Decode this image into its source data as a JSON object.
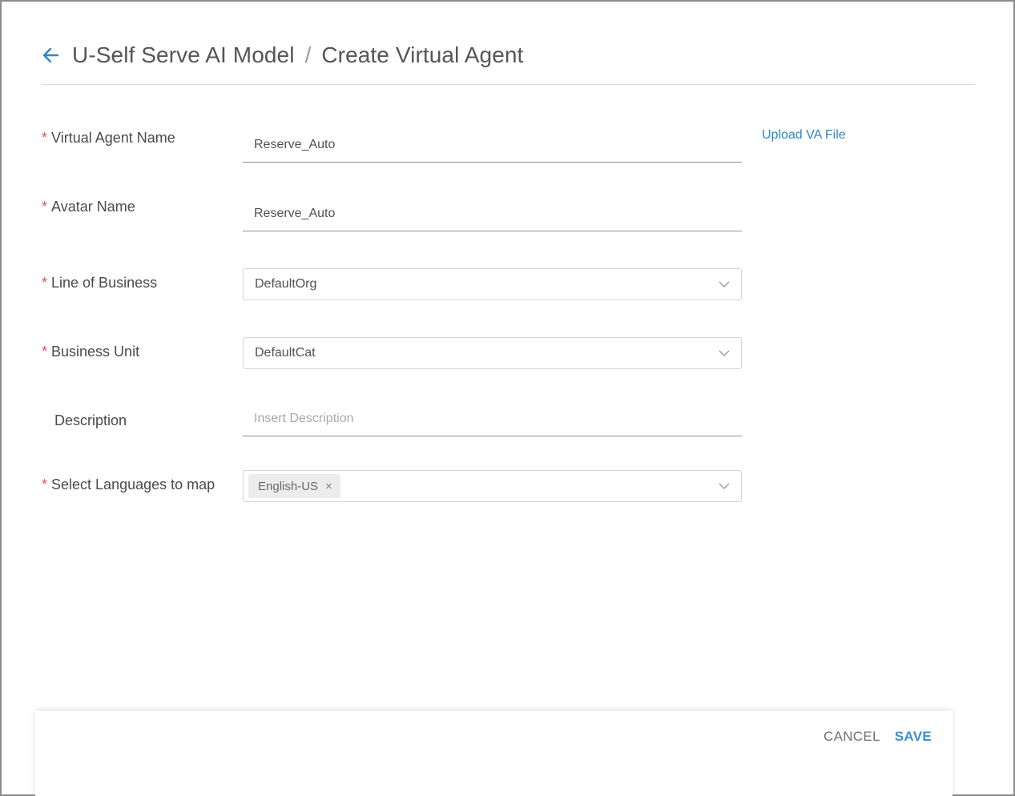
{
  "header": {
    "back_icon": "arrow-left-icon",
    "parent": "U-Self Serve AI Model",
    "separator": "/",
    "title": "Create Virtual Agent",
    "accent_color": "#2f86c6"
  },
  "upload_link": "Upload VA File",
  "form": {
    "required_marker": "*",
    "virtual_agent_name": {
      "label": "Virtual Agent Name",
      "value": "Reserve_Auto"
    },
    "avatar_name": {
      "label": "Avatar Name",
      "value": "Reserve_Auto"
    },
    "line_of_business": {
      "label": "Line of Business",
      "value": "DefaultOrg"
    },
    "business_unit": {
      "label": "Business Unit",
      "value": "DefaultCat"
    },
    "description": {
      "label": "Description",
      "placeholder": "Insert Description"
    },
    "languages": {
      "label": "Select Languages to map",
      "tags": [
        "English-US"
      ],
      "tag_remove": "×"
    }
  },
  "footer": {
    "cancel_label": "CANCEL",
    "save_label": "SAVE"
  }
}
